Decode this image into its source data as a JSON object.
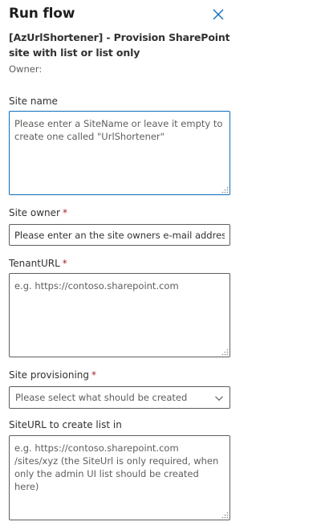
{
  "panel": {
    "title": "Run flow",
    "flow_name": "[AzUrlShortener] - Provision SharePoint site with list or list only",
    "owner_label": "Owner:"
  },
  "fields": {
    "site_name": {
      "label": "Site name",
      "placeholder": "Please enter a SiteName or leave it empty to create one called \"UrlShortener\""
    },
    "site_owner": {
      "label": "Site owner",
      "required_mark": "*",
      "placeholder": "Please enter an the site owners e-mail address"
    },
    "tenant_url": {
      "label": "TenantURL",
      "required_mark": "*",
      "placeholder": "e.g. https://contoso.sharepoint.com"
    },
    "site_provisioning": {
      "label": "Site provisioning",
      "required_mark": "*",
      "selected_text": "Please select what should be created"
    },
    "site_url": {
      "label": "SiteURL to create list in",
      "placeholder": "e.g. https://contoso.sharepoint.com /sites/xyz (the SiteUrl is only required, when only the admin UI list should be created here)"
    }
  },
  "icons": {
    "close": "close-icon",
    "chevron": "chevron-down-icon",
    "grip": "resize-grip-icon"
  },
  "colors": {
    "accent": "#0f6cbd",
    "required": "#a4262c",
    "border": "#605e5c"
  }
}
